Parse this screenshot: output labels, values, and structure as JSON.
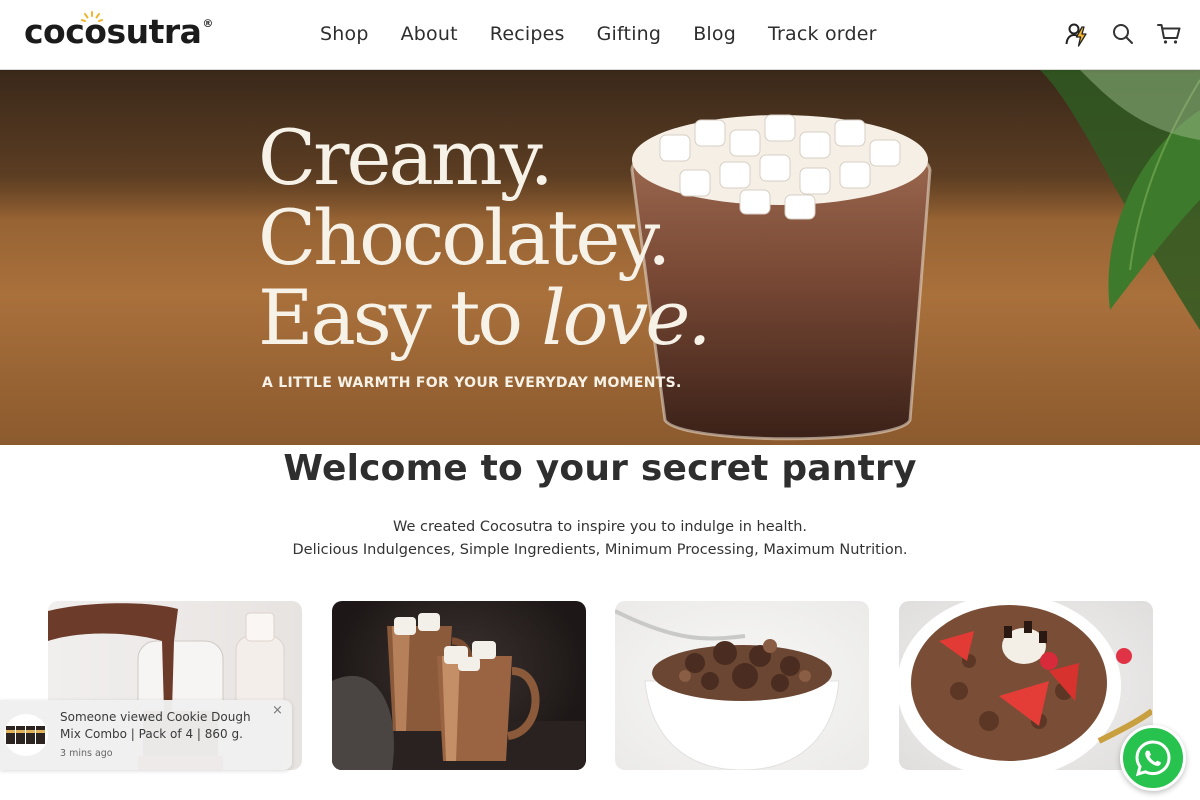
{
  "brand": {
    "name": "cocosutra",
    "registered": "®"
  },
  "nav": {
    "items": [
      {
        "label": "Shop"
      },
      {
        "label": "About"
      },
      {
        "label": "Recipes"
      },
      {
        "label": "Gifting"
      },
      {
        "label": "Blog"
      },
      {
        "label": "Track order"
      }
    ]
  },
  "header_icons": [
    "account-bolt-icon",
    "search-icon",
    "cart-icon"
  ],
  "hero": {
    "line1": "Creamy.",
    "line2": "Chocolatey.",
    "line3_a": "Easy to",
    "line3_b": "love.",
    "subtitle": "A LITTLE WARMTH FOR YOUR EVERYDAY MOMENTS."
  },
  "welcome": {
    "title": "Welcome to your secret pantry",
    "line1": "We created Cocosutra to inspire you to indulge in health.",
    "line2": "Delicious Indulgences, Simple Ingredients, Minimum Processing, Maximum Nutrition."
  },
  "cards": [
    {
      "image": "chocolate-milk-pour-image"
    },
    {
      "image": "hot-chocolate-copper-mugs-image"
    },
    {
      "image": "chocolate-granola-bowl-image"
    },
    {
      "image": "chocolate-oats-strawberry-image"
    }
  ],
  "toast": {
    "text": "Someone viewed Cookie Dough Mix Combo | Pack of 4 | 860 g.",
    "time": "3 mins ago",
    "close": "×"
  },
  "colors": {
    "accent_sun": "#f2b531",
    "whatsapp": "#28c24f",
    "hero_text": "#f7f2e8"
  }
}
